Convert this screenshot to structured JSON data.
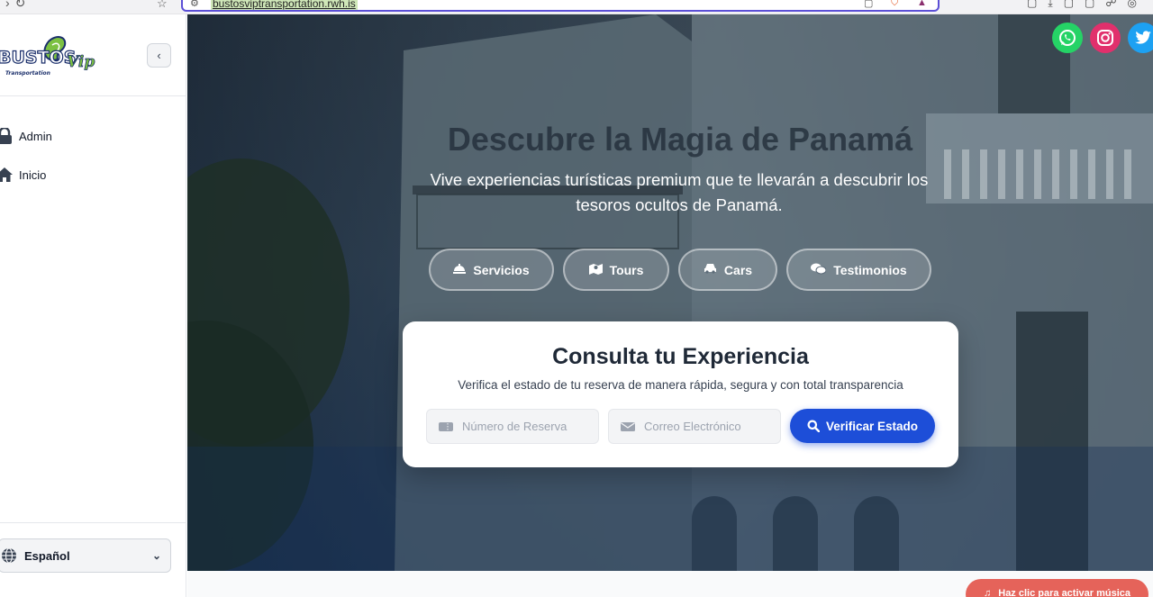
{
  "browser": {
    "url": "bustosviptransportation.rwh.is"
  },
  "sidebar": {
    "logo_text": "BUSTOS",
    "logo_vip": "Vip",
    "logo_tagline": "Transportation",
    "collapse_icon": "chevron-left-icon",
    "items": [
      {
        "label": "Admin",
        "icon": "lock-icon"
      },
      {
        "label": "Inicio",
        "icon": "home-icon"
      }
    ],
    "language": {
      "selected": "Español",
      "icon": "globe-icon"
    }
  },
  "hero": {
    "title": "Descubre la Magia de Panamá",
    "subtitle": "Vive experiencias turísticas premium que te llevarán a descubrir los tesoros ocultos de Panamá.",
    "pills": [
      {
        "label": "Servicios",
        "icon": "concierge-bell-icon"
      },
      {
        "label": "Tours",
        "icon": "map-icon"
      },
      {
        "label": "Cars",
        "icon": "car-icon"
      },
      {
        "label": "Testimonios",
        "icon": "comments-icon"
      }
    ],
    "social": [
      {
        "name": "whatsapp",
        "color": "#25d366"
      },
      {
        "name": "instagram",
        "color": "#e1306c"
      },
      {
        "name": "twitter",
        "color": "#1da1f2"
      }
    ]
  },
  "consulta": {
    "title": "Consulta tu Experiencia",
    "subtitle": "Verifica el estado de tu reserva de manera rápida, segura y con total transparencia",
    "reserva_placeholder": "Número de Reserva",
    "correo_placeholder": "Correo Electrónico",
    "verify_label": "Verificar Estado"
  },
  "music": {
    "label": "Haz clic para activar música"
  },
  "colors": {
    "primary": "#1d4ed8",
    "music": "#e5635a"
  }
}
